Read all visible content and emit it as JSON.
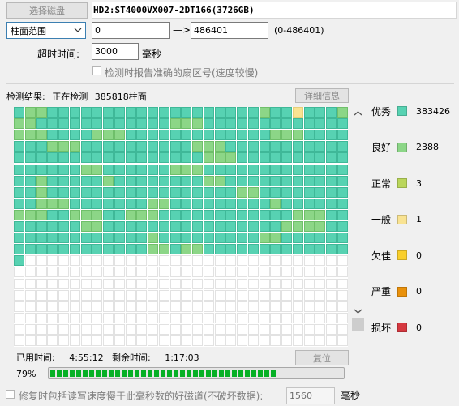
{
  "toolbar": {
    "select_disk_label": "选择磁盘",
    "disk_title": "HD2:ST4000VX007-2DT166(3726GB)"
  },
  "range": {
    "mode_selected": "柱面范围",
    "start_value": "0",
    "arrow": "—>",
    "end_value": "486401",
    "bounds": "(0-486401)"
  },
  "timeout": {
    "label": "超时时间:",
    "value": "3000",
    "unit": "毫秒"
  },
  "report_sector_option": {
    "label": "检测时报告准确的扇区号(速度较慢)",
    "checked": false
  },
  "status": {
    "label": "检测结果:",
    "text": "正在检测",
    "cylinder": "385818柱面",
    "detail_button": "详细信息"
  },
  "scan_map": {
    "total_blocks": 391,
    "warn_blocks": [
      1,
      2,
      22,
      29,
      30,
      31,
      44,
      45,
      46,
      60,
      61,
      62,
      67,
      68,
      69,
      83,
      84,
      85,
      93,
      94,
      95,
      106,
      107,
      108,
      137,
      138,
      139,
      156,
      157,
      164,
      165,
      166,
      182,
      188,
      197,
      198,
      212,
      230,
      231,
      242,
      243,
      244,
      252,
      253,
      263,
      270,
      271,
      272,
      275,
      276,
      277,
      280,
      281,
      282,
      295,
      296,
      297,
      306,
      307,
      324,
      325,
      326,
      327,
      342,
      352,
      353,
      372,
      373,
      375,
      376
    ],
    "amber_blocks": [
      25
    ]
  },
  "legend": [
    {
      "name": "优秀",
      "count": "383426",
      "color": "#57d2b2"
    },
    {
      "name": "良好",
      "count": "2388",
      "color": "#8cd687"
    },
    {
      "name": "正常",
      "count": "3",
      "color": "#bad65b"
    },
    {
      "name": "一般",
      "count": "1",
      "color": "#f9e392"
    },
    {
      "name": "欠佳",
      "count": "0",
      "color": "#f9cf2b"
    },
    {
      "name": "严重",
      "count": "0",
      "color": "#e9910b"
    },
    {
      "name": "损坏",
      "count": "0",
      "color": "#d5383f"
    }
  ],
  "timing": {
    "elapsed_label": "已用时间:",
    "elapsed_value": "4:55:12",
    "remaining_label": "剩余时间:",
    "remaining_value": "1:17:03",
    "reset_button": "复位"
  },
  "progress": {
    "percent_text": "79%",
    "fraction": 0.79
  },
  "repair_option": {
    "label": "修复时包括读写速度慢于此毫秒数的好磁道(不破坏数据):",
    "value": "1560",
    "unit": "毫秒",
    "checked": false
  },
  "colors": {
    "excellent": "#57d2b2",
    "good": "#8cd687",
    "progress_green": "#06b025"
  }
}
